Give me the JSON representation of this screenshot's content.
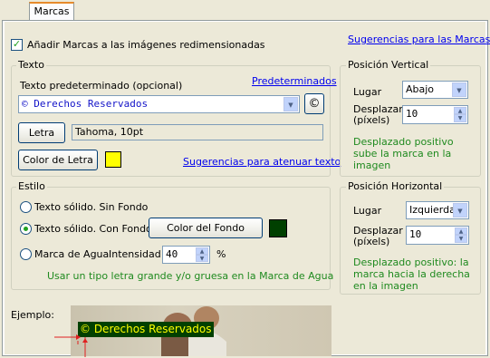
{
  "tab": {
    "label": "Marcas"
  },
  "top": {
    "add_marks_label": "Añadir Marcas a las imágenes redimensionadas",
    "add_marks_checked": true,
    "suggestions_link": "Sugerencias para las Marcas"
  },
  "texto": {
    "title": "Texto",
    "default_text_label": "Texto predeterminado (opcional)",
    "defaults_link": "Predeterminados",
    "text_value": "© Derechos Reservados",
    "copyright_button": "©",
    "font_button": "Letra",
    "font_value": "Tahoma, 10pt",
    "color_button": "Color de Letra",
    "text_color": "#ffff00",
    "fade_link": "Sugerencias para atenuar texto"
  },
  "estilo": {
    "title": "Estilo",
    "options": [
      {
        "label": "Texto sólido. Sin Fondo",
        "selected": false
      },
      {
        "label": "Texto sólido. Con Fondo",
        "selected": true
      },
      {
        "label": "Marca de Agua",
        "selected": false
      }
    ],
    "bg_color_button": "Color del Fondo",
    "bg_color": "#004000",
    "intensity_label": "Intensidad",
    "intensity_value": "40",
    "intensity_unit": "%",
    "hint": "Usar un tipo letra grande y/o gruesa en la Marca de Agua"
  },
  "vertical": {
    "title": "Posición Vertical",
    "place_label": "Lugar",
    "place_value": "Abajo",
    "offset_label_1": "Desplazar",
    "offset_label_2": "(píxels)",
    "offset_value": "10",
    "hint": "Desplazado positivo sube la marca en la imagen"
  },
  "horizontal": {
    "title": "Posición Horizontal",
    "place_label": "Lugar",
    "place_value": "Izquierda",
    "offset_label_1": "Desplazar",
    "offset_label_2": "(píxels)",
    "offset_value": "10",
    "hint": "Desplazado positivo: la marca hacia la derecha en la imagen"
  },
  "example": {
    "label": "Ejemplo:",
    "preview_text": "© Derechos Reservados"
  },
  "colors": {
    "link": "#0000ee",
    "hint_green": "#1f8a1f",
    "tab_highlight": "#e68b2c"
  }
}
